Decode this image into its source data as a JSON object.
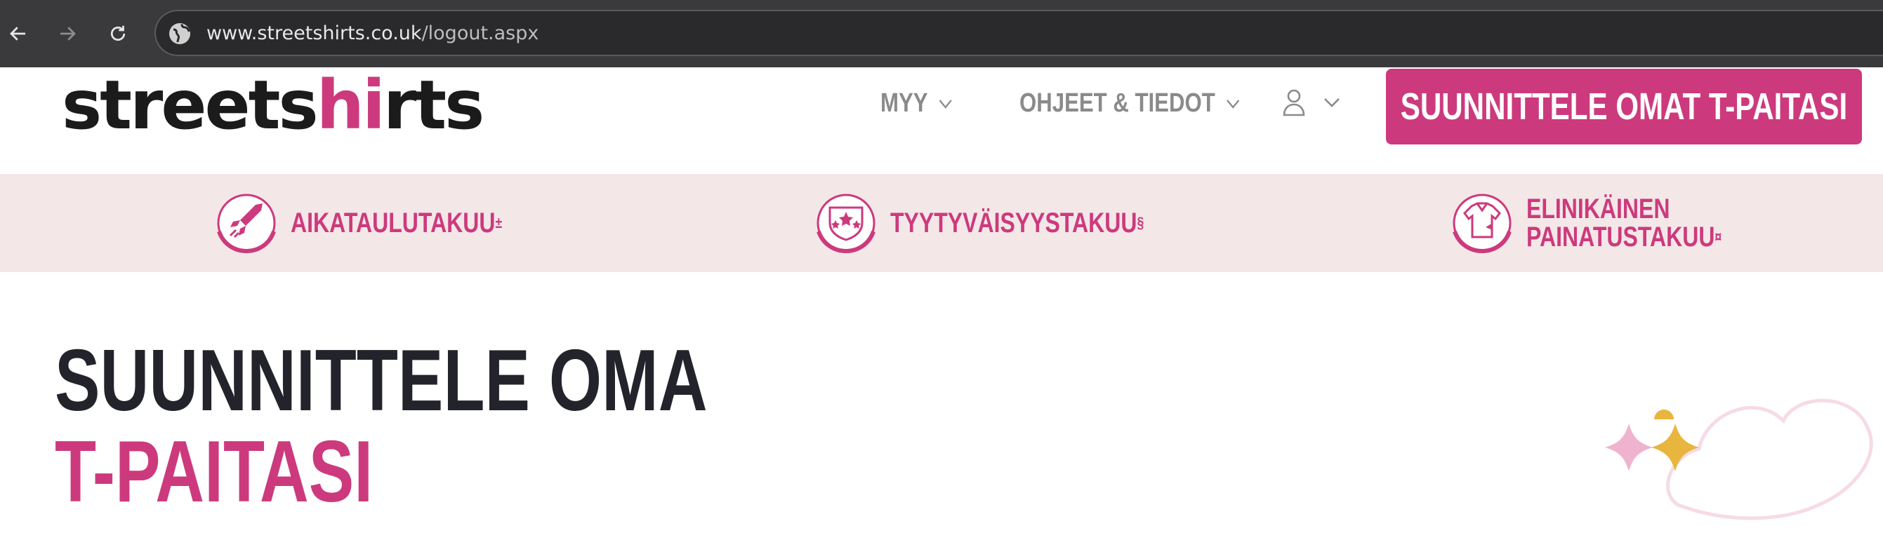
{
  "browser": {
    "url_host": "www.streetshirts.co.uk",
    "url_path": "/logout.aspx"
  },
  "header": {
    "logo_pre": "streets",
    "logo_mid": "hi",
    "logo_post": "rts",
    "menu": [
      {
        "label": "MYY"
      },
      {
        "label": "OHJEET & TIEDOT"
      }
    ],
    "cta_label": "SUUNNITTELE OMAT T-PAITASI"
  },
  "guarantees": [
    {
      "line1": "AIKATAULUTAKUU",
      "mark": "±",
      "icon": "rocket-icon"
    },
    {
      "line1": "TYYTYVÄISYYSTAKUU",
      "mark": "§",
      "icon": "stars-shield-icon"
    },
    {
      "line1": "ELINIKÄINEN",
      "line2": "PAINATUSTAKUU",
      "mark": "¤",
      "icon": "shirt-icon"
    }
  ],
  "hero": {
    "line1": "SUUNNITTELE OMA",
    "line2": "T-PAITASI"
  },
  "colors": {
    "brand_pink": "#cc3a7d",
    "strip_bg": "#f4e7e7",
    "dark_text": "#23242b",
    "accent_yellow": "#e8b63e",
    "accent_light_pink": "#efb3cf"
  }
}
